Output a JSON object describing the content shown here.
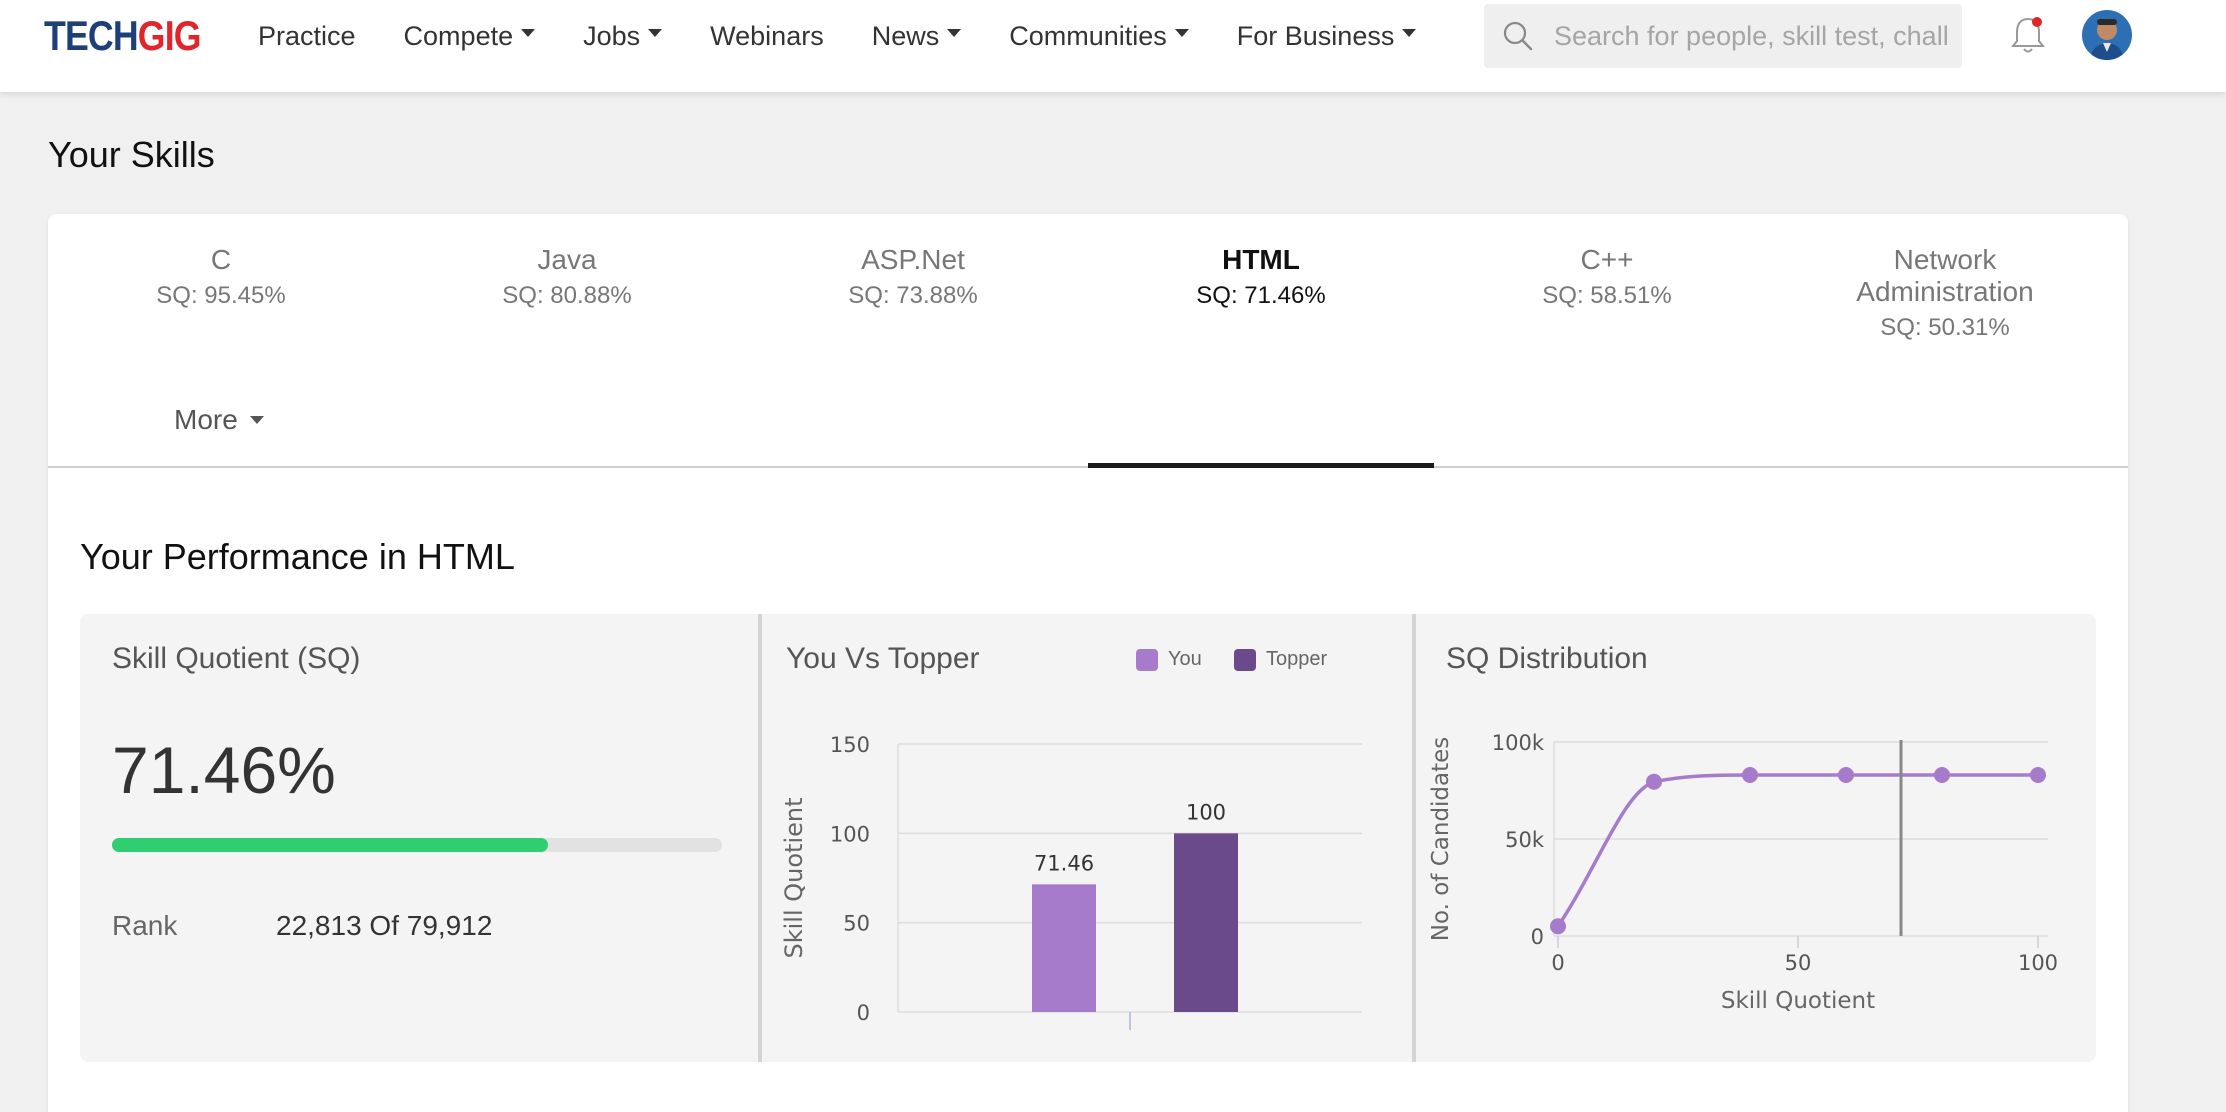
{
  "header": {
    "logo_part1": "TECH",
    "logo_part2": "GIG",
    "nav": [
      {
        "label": "Practice",
        "dropdown": false
      },
      {
        "label": "Compete",
        "dropdown": true
      },
      {
        "label": "Jobs",
        "dropdown": true
      },
      {
        "label": "Webinars",
        "dropdown": false
      },
      {
        "label": "News",
        "dropdown": true
      },
      {
        "label": "Communities",
        "dropdown": true
      },
      {
        "label": "For Business",
        "dropdown": true
      }
    ],
    "search_placeholder": "Search for people, skill test, chall",
    "icons": [
      "search-icon",
      "bell-icon",
      "avatar"
    ],
    "notification_dot_color": "#e0252b"
  },
  "page_title": "Your Skills",
  "skills_tabs": [
    {
      "name": "C",
      "sq": "SQ: 95.45%",
      "active": false
    },
    {
      "name": "Java",
      "sq": "SQ: 80.88%",
      "active": false
    },
    {
      "name": "ASP.Net",
      "sq": "SQ: 73.88%",
      "active": false
    },
    {
      "name": "HTML",
      "sq": "SQ: 71.46%",
      "active": true
    },
    {
      "name": "C++",
      "sq": "SQ: 58.51%",
      "active": false
    },
    {
      "name": "Network Administration",
      "sq": "SQ: 50.31%",
      "active": false
    }
  ],
  "more_label": "More",
  "performance_title": "Your Performance in HTML",
  "sq_panel": {
    "title": "Skill Quotient (SQ)",
    "value": "71.46%",
    "progress_fraction": 0.7146,
    "progress_color": "#2fce70",
    "rank_label": "Rank",
    "rank_value": "22,813 Of 79,912"
  },
  "chart_data": [
    {
      "type": "bar",
      "title": "You Vs Topper",
      "ylabel": "Skill Quotient",
      "xlabel": "",
      "ylim": [
        0,
        150
      ],
      "yticks": [
        0,
        50,
        100,
        150
      ],
      "grid": true,
      "legend_position": "top-right",
      "series": [
        {
          "name": "You",
          "values": [
            71.46
          ],
          "color": "#a77bcc",
          "label": "71.46"
        },
        {
          "name": "Topper",
          "values": [
            100
          ],
          "color": "#6a4a8a",
          "label": "100"
        }
      ]
    },
    {
      "type": "line",
      "title": "SQ Distribution",
      "xlabel": "Skill Quotient",
      "ylabel": "No. of Candidates",
      "xlim": [
        0,
        100
      ],
      "ylim": [
        0,
        100000
      ],
      "xticks": [
        0,
        50,
        100
      ],
      "yticks": [
        {
          "value": 0,
          "label": "0"
        },
        {
          "value": 50000,
          "label": "50k"
        },
        {
          "value": 100000,
          "label": "100k"
        }
      ],
      "grid": true,
      "series": [
        {
          "color": "#a77bcc",
          "x": [
            0,
            20,
            40,
            60,
            80,
            100
          ],
          "y": [
            5000,
            79500,
            83000,
            83000,
            83000,
            83000
          ]
        }
      ],
      "marker_x": 71.46
    }
  ]
}
